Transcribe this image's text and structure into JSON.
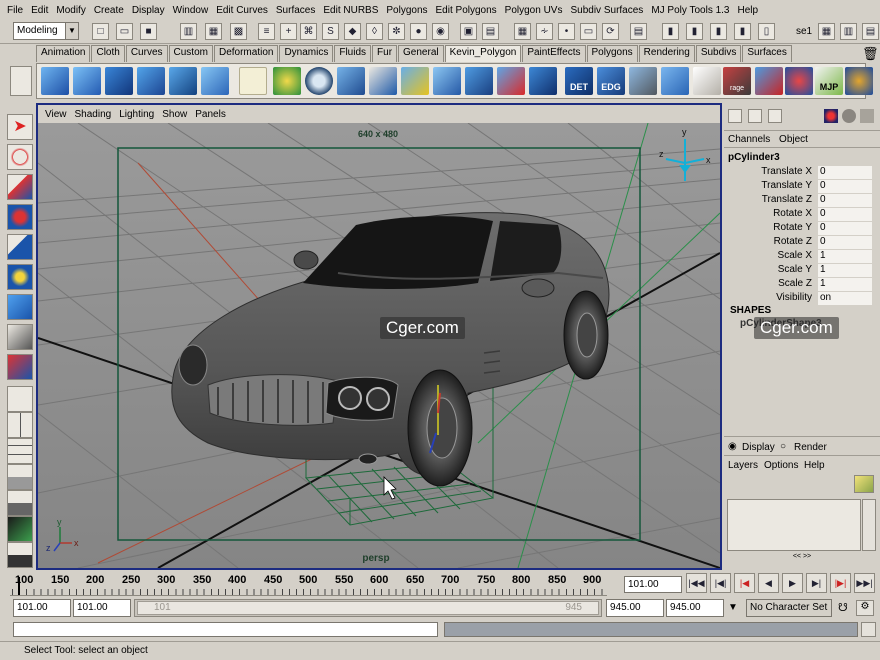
{
  "menubar": {
    "items": [
      "File",
      "Edit",
      "Modify",
      "Create",
      "Display",
      "Window",
      "Edit Curves",
      "Surfaces",
      "Edit NURBS",
      "Polygons",
      "Edit Polygons",
      "Polygon UVs",
      "Subdiv Surfaces",
      "MJ Poly Tools 1.3",
      "Help"
    ]
  },
  "statusline": {
    "mode": "Modeling",
    "selection_field": "se1"
  },
  "shelf": {
    "tabs": [
      "Animation",
      "Cloth",
      "Curves",
      "Custom",
      "Deformation",
      "Dynamics",
      "Fluids",
      "Fur",
      "General",
      "Kevin_Polygon",
      "PaintEffects",
      "Polygons",
      "Rendering",
      "Subdivs",
      "Surfaces"
    ],
    "active_tab": "Kevin_Polygon",
    "icon_labels": [
      "DET",
      "EDG",
      "rage",
      "MJP"
    ]
  },
  "viewport": {
    "menu": [
      "View",
      "Shading",
      "Lighting",
      "Show",
      "Panels"
    ],
    "resolution_label": "640 x 480",
    "camera_label": "persp",
    "axis_x": "x",
    "axis_y": "y",
    "axis_z": "z"
  },
  "channelbox": {
    "menu": [
      "Channels",
      "Object"
    ],
    "object_name": "pCylinder3",
    "attributes": [
      {
        "label": "Translate X",
        "value": "0"
      },
      {
        "label": "Translate Y",
        "value": "0"
      },
      {
        "label": "Translate Z",
        "value": "0"
      },
      {
        "label": "Rotate X",
        "value": "0"
      },
      {
        "label": "Rotate Y",
        "value": "0"
      },
      {
        "label": "Rotate Z",
        "value": "0"
      },
      {
        "label": "Scale X",
        "value": "1"
      },
      {
        "label": "Scale Y",
        "value": "1"
      },
      {
        "label": "Scale Z",
        "value": "1"
      },
      {
        "label": "Visibility",
        "value": "on"
      }
    ],
    "shapes_header": "SHAPES",
    "shape_name": "pCylinderShape3"
  },
  "layers": {
    "display_label": "Display",
    "render_label": "Render",
    "menu": [
      "Layers",
      "Options",
      "Help"
    ],
    "selected": "Display"
  },
  "timeslider": {
    "ticks": [
      "100",
      "150",
      "200",
      "250",
      "300",
      "350",
      "400",
      "450",
      "500",
      "550",
      "600",
      "650",
      "700",
      "750",
      "800",
      "850",
      "900"
    ],
    "current_frame": "101.00"
  },
  "rangeslider": {
    "start": "101.00",
    "playback_start": "101.00",
    "range_start_label": "101",
    "range_end_label": "945",
    "playback_end": "945.00",
    "end": "945.00",
    "character_set": "No Character Set"
  },
  "helpline": {
    "text": "Select Tool: select an object"
  },
  "watermark": {
    "text": "Cger.com"
  }
}
